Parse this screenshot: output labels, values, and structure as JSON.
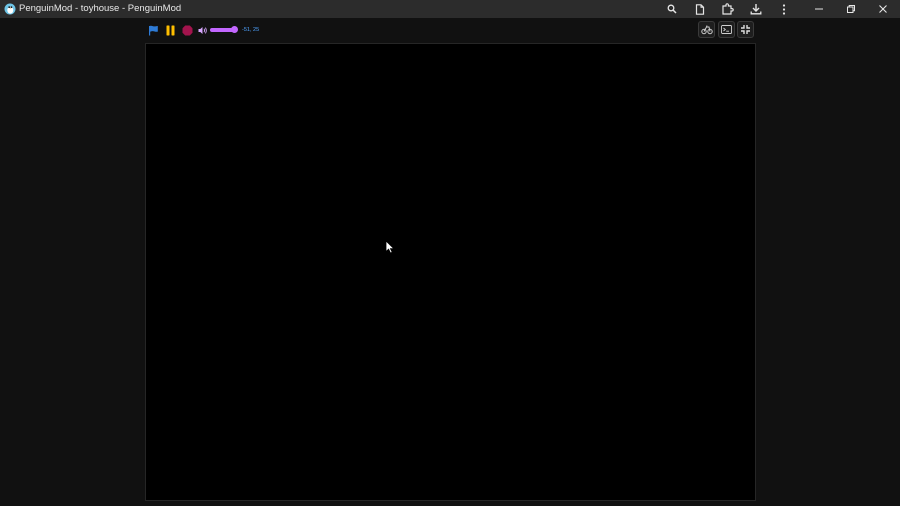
{
  "window": {
    "title": "PenguinMod - toyhouse - PenguinMod",
    "icons": {
      "app": "penguin-logo-icon",
      "zoom": "zoom-icon",
      "page": "page-icon",
      "extensions": "extension-puzzle-icon",
      "download": "download-icon",
      "menu": "more-vertical-icon",
      "minimize": "minimize-icon",
      "restore": "restore-icon",
      "close": "close-icon"
    }
  },
  "player": {
    "coords": "-51, 25",
    "volume_percent": 90,
    "controls": {
      "green_flag": "flag-icon",
      "pause": "pause-icon",
      "stop": "stop-icon",
      "volume": "volume-icon",
      "turbo": "turbo-icon",
      "terminal": "terminal-icon",
      "fullscreen": "fullscreen-icon"
    }
  },
  "colors": {
    "titlebar_bg": "#2c2c2c",
    "page_bg": "#111111",
    "stage_bg": "#000000",
    "flag_blue": "#2e7bd6",
    "pause_yellow": "#ffbf00",
    "stop_red": "#a3144d",
    "accent_purple": "#c267ff",
    "coords_blue": "#4fa3ff"
  }
}
